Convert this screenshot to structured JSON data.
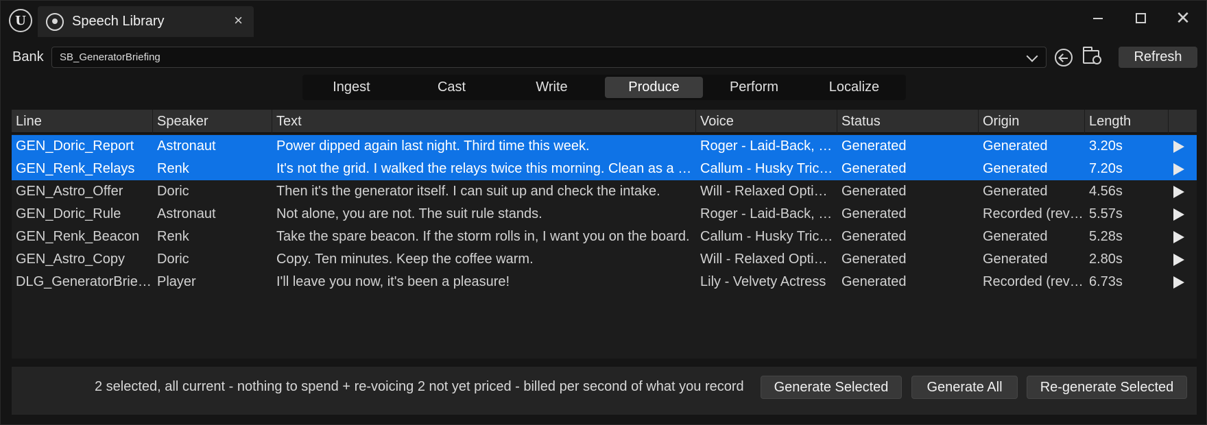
{
  "window": {
    "tab_title": "Speech Library",
    "tab_close": "×",
    "close_glyph": "✕"
  },
  "bank": {
    "label": "Bank",
    "value": "SB_GeneratorBriefing",
    "refresh_label": "Refresh"
  },
  "modes": {
    "items": [
      "Ingest",
      "Cast",
      "Write",
      "Produce",
      "Perform",
      "Localize"
    ],
    "active": "Produce"
  },
  "table": {
    "columns": [
      "Line",
      "Speaker",
      "Text",
      "Voice",
      "Status",
      "Origin",
      "Length"
    ],
    "rows": [
      {
        "line": "GEN_Doric_Report",
        "speaker": "Astronaut",
        "text": "Power dipped again last night. Third time this week.",
        "voice": "Roger - Laid-Back, C...",
        "status": "Generated",
        "origin": "Generated",
        "length": "3.20s",
        "selected": true
      },
      {
        "line": "GEN_Renk_Relays",
        "speaker": "Renk",
        "text": "It's not the grid. I walked the relays twice this morning. Clean as a w...",
        "voice": "Callum - Husky Trick...",
        "status": "Generated",
        "origin": "Generated",
        "length": "7.20s",
        "selected": true
      },
      {
        "line": "GEN_Astro_Offer",
        "speaker": "Doric",
        "text": "Then it's the generator itself. I can suit up and check the intake.",
        "voice": "Will - Relaxed Optimi...",
        "status": "Generated",
        "origin": "Generated",
        "length": "4.56s",
        "selected": false
      },
      {
        "line": "GEN_Doric_Rule",
        "speaker": "Astronaut",
        "text": "Not alone, you are not. The suit rule stands.",
        "voice": "Roger - Laid-Back, C...",
        "status": "Generated",
        "origin": "Recorded (revo...",
        "length": "5.57s",
        "selected": false
      },
      {
        "line": "GEN_Renk_Beacon",
        "speaker": "Renk",
        "text": "Take the spare beacon. If the storm rolls in, I want you on the board.",
        "voice": "Callum - Husky Trick...",
        "status": "Generated",
        "origin": "Generated",
        "length": "5.28s",
        "selected": false
      },
      {
        "line": "GEN_Astro_Copy",
        "speaker": "Doric",
        "text": "Copy. Ten minutes. Keep the coffee warm.",
        "voice": "Will - Relaxed Optimi...",
        "status": "Generated",
        "origin": "Generated",
        "length": "2.80s",
        "selected": false
      },
      {
        "line": "DLG_GeneratorBriefi...",
        "speaker": "Player",
        "text": "I'll leave you now, it's been a pleasure!",
        "voice": "Lily - Velvety Actress",
        "status": "Generated",
        "origin": "Recorded (revo...",
        "length": "6.73s",
        "selected": false
      }
    ]
  },
  "footer": {
    "summary": "2 selected, all current - nothing to spend  +  re-voicing 2 not yet priced - billed per second of what you record",
    "generate_selected": "Generate Selected",
    "generate_all": "Generate All",
    "regenerate_selected": "Re-generate Selected"
  },
  "colors": {
    "selection": "#0f73e6",
    "background": "#151515",
    "header": "#2f2f2f"
  }
}
